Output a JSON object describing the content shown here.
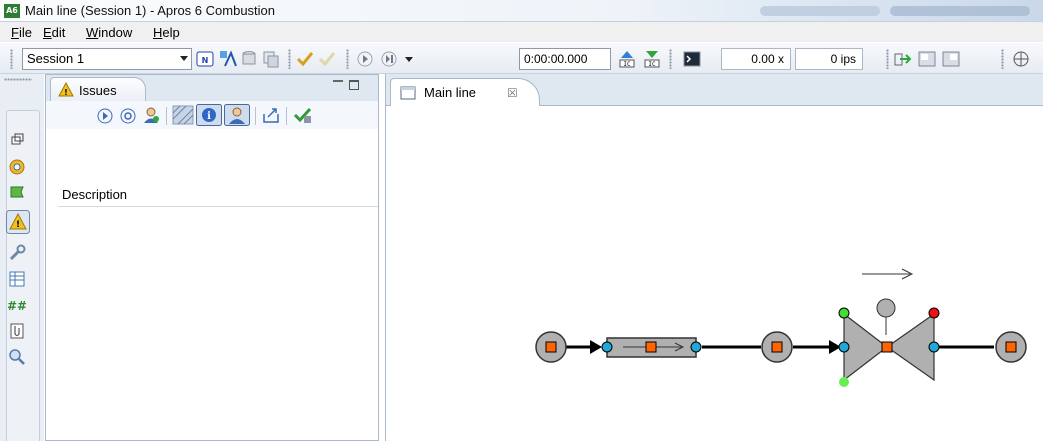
{
  "window": {
    "title": "Main line (Session 1) - Apros 6 Combustion",
    "app_badge": "A6"
  },
  "menu": [
    "File",
    "Edit",
    "Window",
    "Help"
  ],
  "toolbar": {
    "session": "Session 1",
    "sim_time": "0:00:00.000",
    "speed": "0.00 x",
    "ips": "0 ips",
    "icons": [
      "normalize-icon",
      "translate-icon",
      "database-icon",
      "copy-icon",
      "check-icon",
      "uncheck-icon",
      "play-icon",
      "step-icon",
      "dropdown-icon",
      "save-ic-icon",
      "load-ic-icon",
      "console-icon",
      "export-icon",
      "layout-icon",
      "layout2-icon",
      "move-icon"
    ]
  },
  "sidebar": {
    "icons": [
      "restore-icon",
      "gear-icon",
      "flag-icon",
      "warning-icon",
      "wrench-icon",
      "table-icon",
      "hash-icon",
      "clip-icon",
      "search-icon"
    ]
  },
  "issues": {
    "tab_label": "Issues",
    "column_header": "Description"
  },
  "editor": {
    "tab_label": "Main line",
    "close_glyph": "☒"
  },
  "colors": {
    "node_fill": "#b0b0b0",
    "port_blue": "#1fa8d8",
    "port_green": "#44dd33",
    "port_red": "#ee1111",
    "center_orange": "#ff6600"
  }
}
